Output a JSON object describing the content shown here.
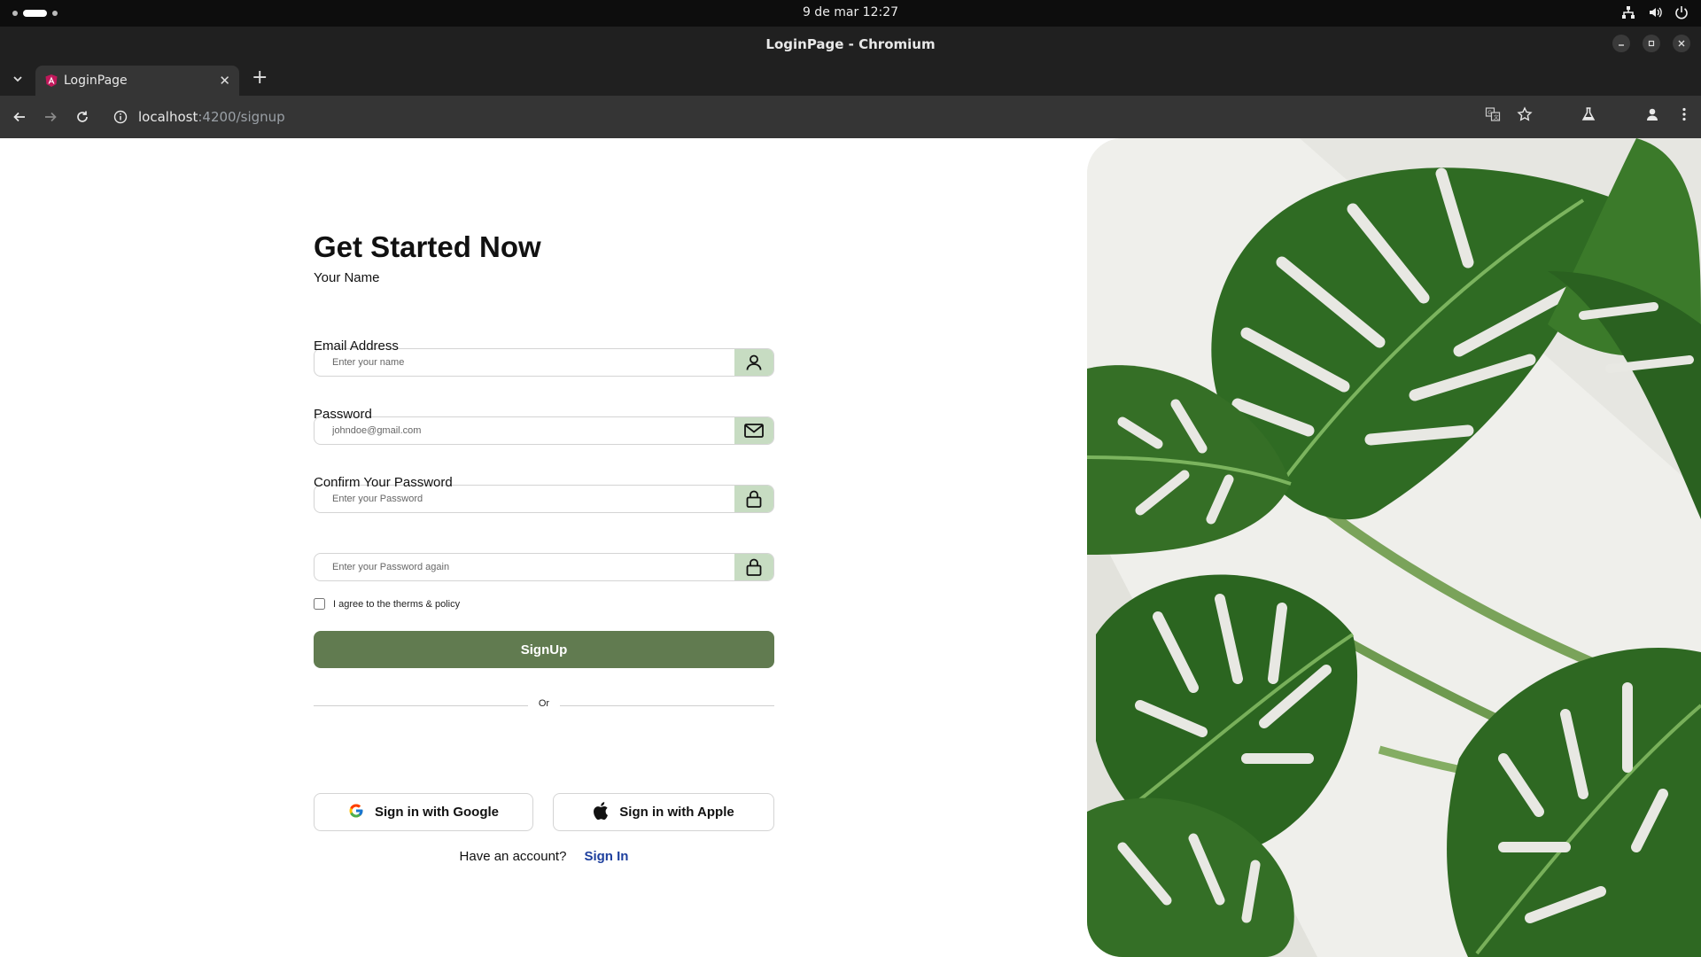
{
  "system_bar": {
    "clock": "9 de mar  12:27"
  },
  "window": {
    "title": "LoginPage - Chromium"
  },
  "browser": {
    "tab": {
      "title": "LoginPage"
    },
    "url": {
      "host": "localhost",
      "path": ":4200/signup"
    }
  },
  "signup": {
    "heading": "Get Started Now",
    "fields": [
      {
        "label": "Your Name",
        "placeholder": "Enter your name",
        "icon": "user-icon"
      },
      {
        "label": "Email Address",
        "placeholder": "johndoe@gmail.com",
        "icon": "mail-icon"
      },
      {
        "label": "Password",
        "placeholder": "Enter your Password",
        "icon": "lock-icon"
      },
      {
        "label": "Confirm Your Password",
        "placeholder": "Enter your Password again",
        "icon": "lock-icon"
      }
    ],
    "agree_label": "I agree to the therms & policy",
    "submit_label": "SignUp",
    "divider_label": "Or",
    "google_label": "Sign in with Google",
    "apple_label": "Sign in with Apple",
    "have_account": "Have an account?",
    "sign_in_link": "Sign In"
  },
  "colors": {
    "primary_button": "#617b50",
    "field_icon_bg": "#c7dcc2",
    "sign_in_link": "#1d3f9e"
  }
}
